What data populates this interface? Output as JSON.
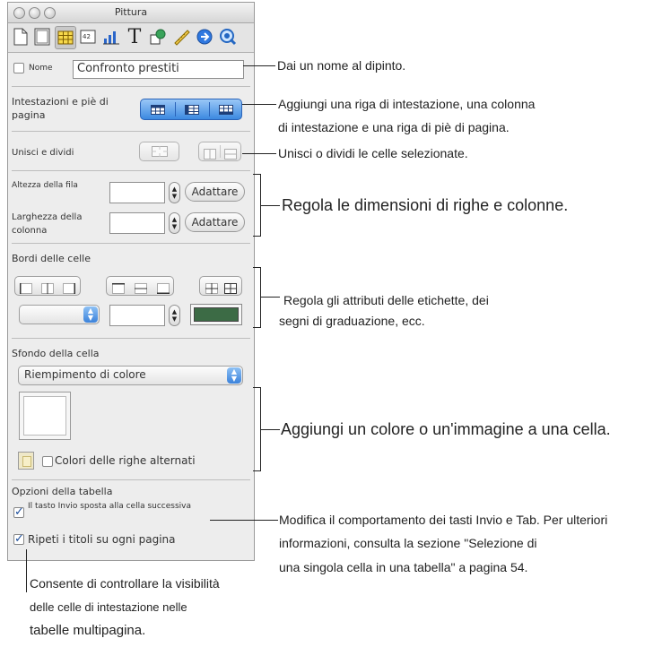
{
  "window": {
    "title": "Pittura"
  },
  "toolbar": {
    "items": [
      "document-icon",
      "layout-icon",
      "table-icon",
      "metrics-icon",
      "chart-icon",
      "text-icon",
      "graphic-icon",
      "ruler-icon",
      "link-icon",
      "quicktime-icon"
    ],
    "metrics_badge": "42",
    "text_glyph": "T"
  },
  "name_row": {
    "label": "Nome",
    "value": "Confronto prestiti"
  },
  "headers": {
    "label": "Intestazioni e piè di pagina"
  },
  "merge": {
    "label": "Unisci e dividi"
  },
  "size": {
    "row_height_label": "Altezza della fila",
    "col_width_label": "Larghezza della colonna",
    "fit_label": "Adattare"
  },
  "borders": {
    "label": "Bordi delle celle",
    "color": "#3c6b45"
  },
  "background": {
    "label": "Sfondo della cella",
    "fill_option": "Riempimento di colore",
    "alternate_label": "Colori delle righe alternati"
  },
  "options": {
    "label": "Opzioni della tabella",
    "enter_moves_label": "Il tasto Invio sposta alla cella successiva",
    "repeat_titles_label": "Ripeti i titoli su ogni pagina"
  },
  "annotations": {
    "name": "Dai un nome al dipinto.",
    "headers_1": "Aggiungi una riga di intestazione, una colonna",
    "headers_2": "di intestazione e una riga di piè di pagina.",
    "merge": "Unisci o dividi le celle selezionate.",
    "size": "Regola le dimensioni di righe e colonne.",
    "borders_1": "Regola gli attributi delle etichette, dei",
    "borders_2": "segni di graduazione, ecc.",
    "background": "Aggiungi un colore o un'immagine a una cella.",
    "enter_1": "Modifica il comportamento dei tasti Invio e Tab. Per ulteriori",
    "enter_2": "informazioni, consulta la sezione \"Selezione di",
    "enter_3": "una singola cella in una tabella\" a pagina 54.",
    "repeat_1": "Consente di controllare la visibilità",
    "repeat_2": "delle celle di intestazione nelle",
    "repeat_3": "tabelle multipagina."
  }
}
